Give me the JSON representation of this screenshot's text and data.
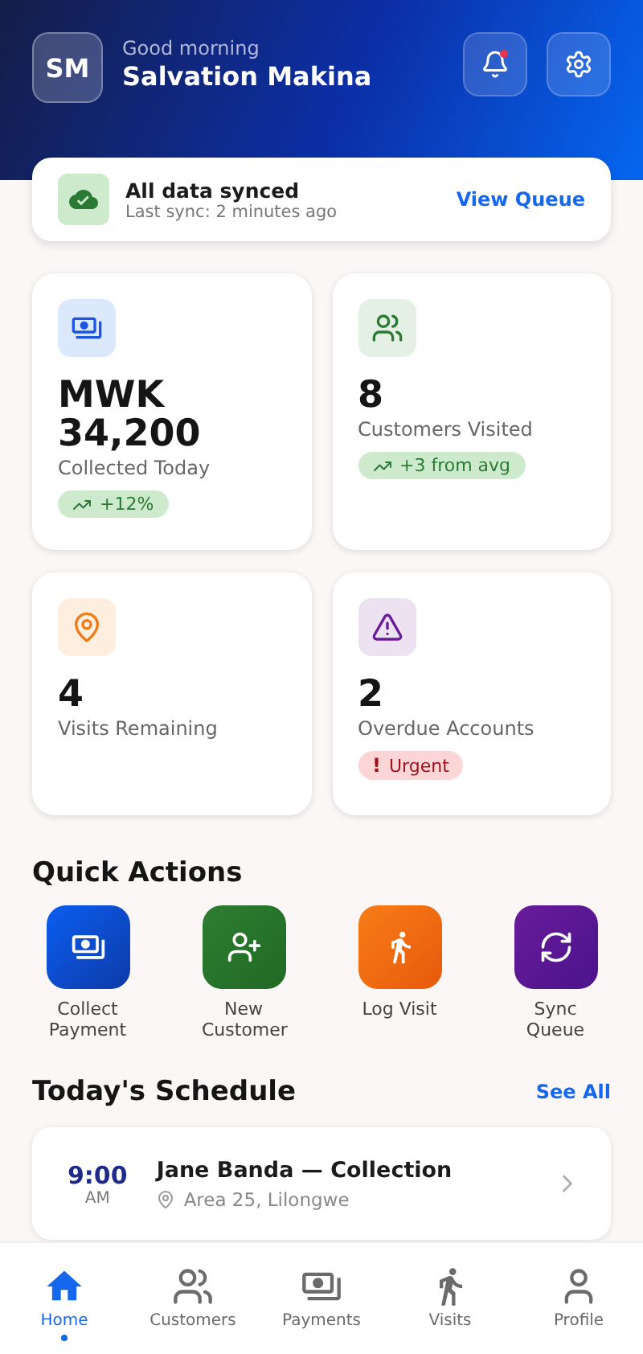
{
  "header": {
    "initials": "SM",
    "greeting": "Good morning",
    "name": "Salvation Makina",
    "notifications_unread": true
  },
  "sync": {
    "title": "All data synced",
    "subtitle": "Last sync: 2 minutes ago",
    "action": "View Queue"
  },
  "stats": [
    {
      "value": "MWK 34,200",
      "label": "Collected Today",
      "badge": {
        "kind": "trend",
        "text": "+12%"
      }
    },
    {
      "value": "8",
      "label": "Customers Visited",
      "badge": {
        "kind": "trend",
        "text": "+3 from avg"
      }
    },
    {
      "value": "4",
      "label": "Visits Remaining"
    },
    {
      "value": "2",
      "label": "Overdue Accounts",
      "badge": {
        "kind": "urgent",
        "mark": "!",
        "text": "Urgent"
      }
    }
  ],
  "quick_actions": {
    "title": "Quick Actions",
    "items": [
      {
        "label": "Collect Payment"
      },
      {
        "label": "New Customer"
      },
      {
        "label": "Log Visit"
      },
      {
        "label": "Sync Queue"
      }
    ]
  },
  "schedule": {
    "title": "Today's Schedule",
    "action": "See All",
    "items": [
      {
        "time": "9:00",
        "period": "AM",
        "title": "Jane Banda — Collection",
        "location": "Area 25, Lilongwe"
      }
    ]
  },
  "nav": [
    {
      "label": "Home",
      "selected": true
    },
    {
      "label": "Customers",
      "selected": false
    },
    {
      "label": "Payments",
      "selected": false
    },
    {
      "label": "Visits",
      "selected": false
    },
    {
      "label": "Profile",
      "selected": false
    }
  ]
}
